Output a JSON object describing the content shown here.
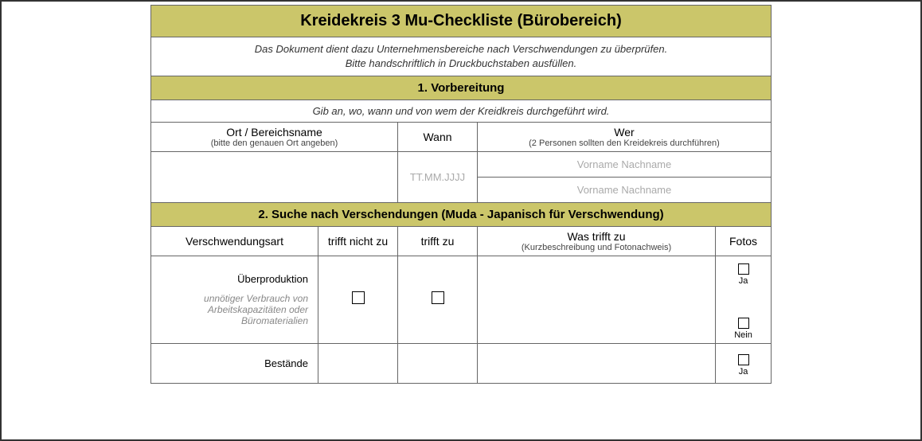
{
  "title": "Kreidekreis 3 Mu-Checkliste (Bürobereich)",
  "subtitle_line1": "Das Dokument dient dazu Unternehmensbereiche nach Verschwendungen zu überprüfen.",
  "subtitle_line2": "Bitte handschriftlich in Druckbuchstaben ausfüllen.",
  "section1": {
    "heading": "1. Vorbereitung",
    "instruction": "Gib an, wo, wann und von wem der Kreidkreis durchgeführt wird.",
    "col_ort": "Ort / Bereichsname",
    "col_ort_sub": "(bitte den genauen Ort angeben)",
    "col_wann": "Wann",
    "col_wer": "Wer",
    "col_wer_sub": "(2 Personen sollten den Kreidekreis durchführen)",
    "ph_date": "TT.MM.JJJJ",
    "ph_name": "Vorname Nachname"
  },
  "section2": {
    "heading": "2. Suche nach Verschendungen (Muda - Japanisch für Verschwendung)",
    "col_art": "Verschwendungsart",
    "col_nein": "trifft nicht zu",
    "col_ja": "trifft zu",
    "col_was": "Was trifft zu",
    "col_was_sub": "(Kurzbeschreibung und Fotonachweis)",
    "col_fotos": "Fotos",
    "photo_yes": "Ja",
    "photo_no": "Nein",
    "rows": [
      {
        "name": "Überproduktion",
        "desc": "unnötiger Verbrauch von Arbeitskapazitäten oder Büromaterialien"
      },
      {
        "name": "Bestände",
        "desc": ""
      }
    ]
  }
}
